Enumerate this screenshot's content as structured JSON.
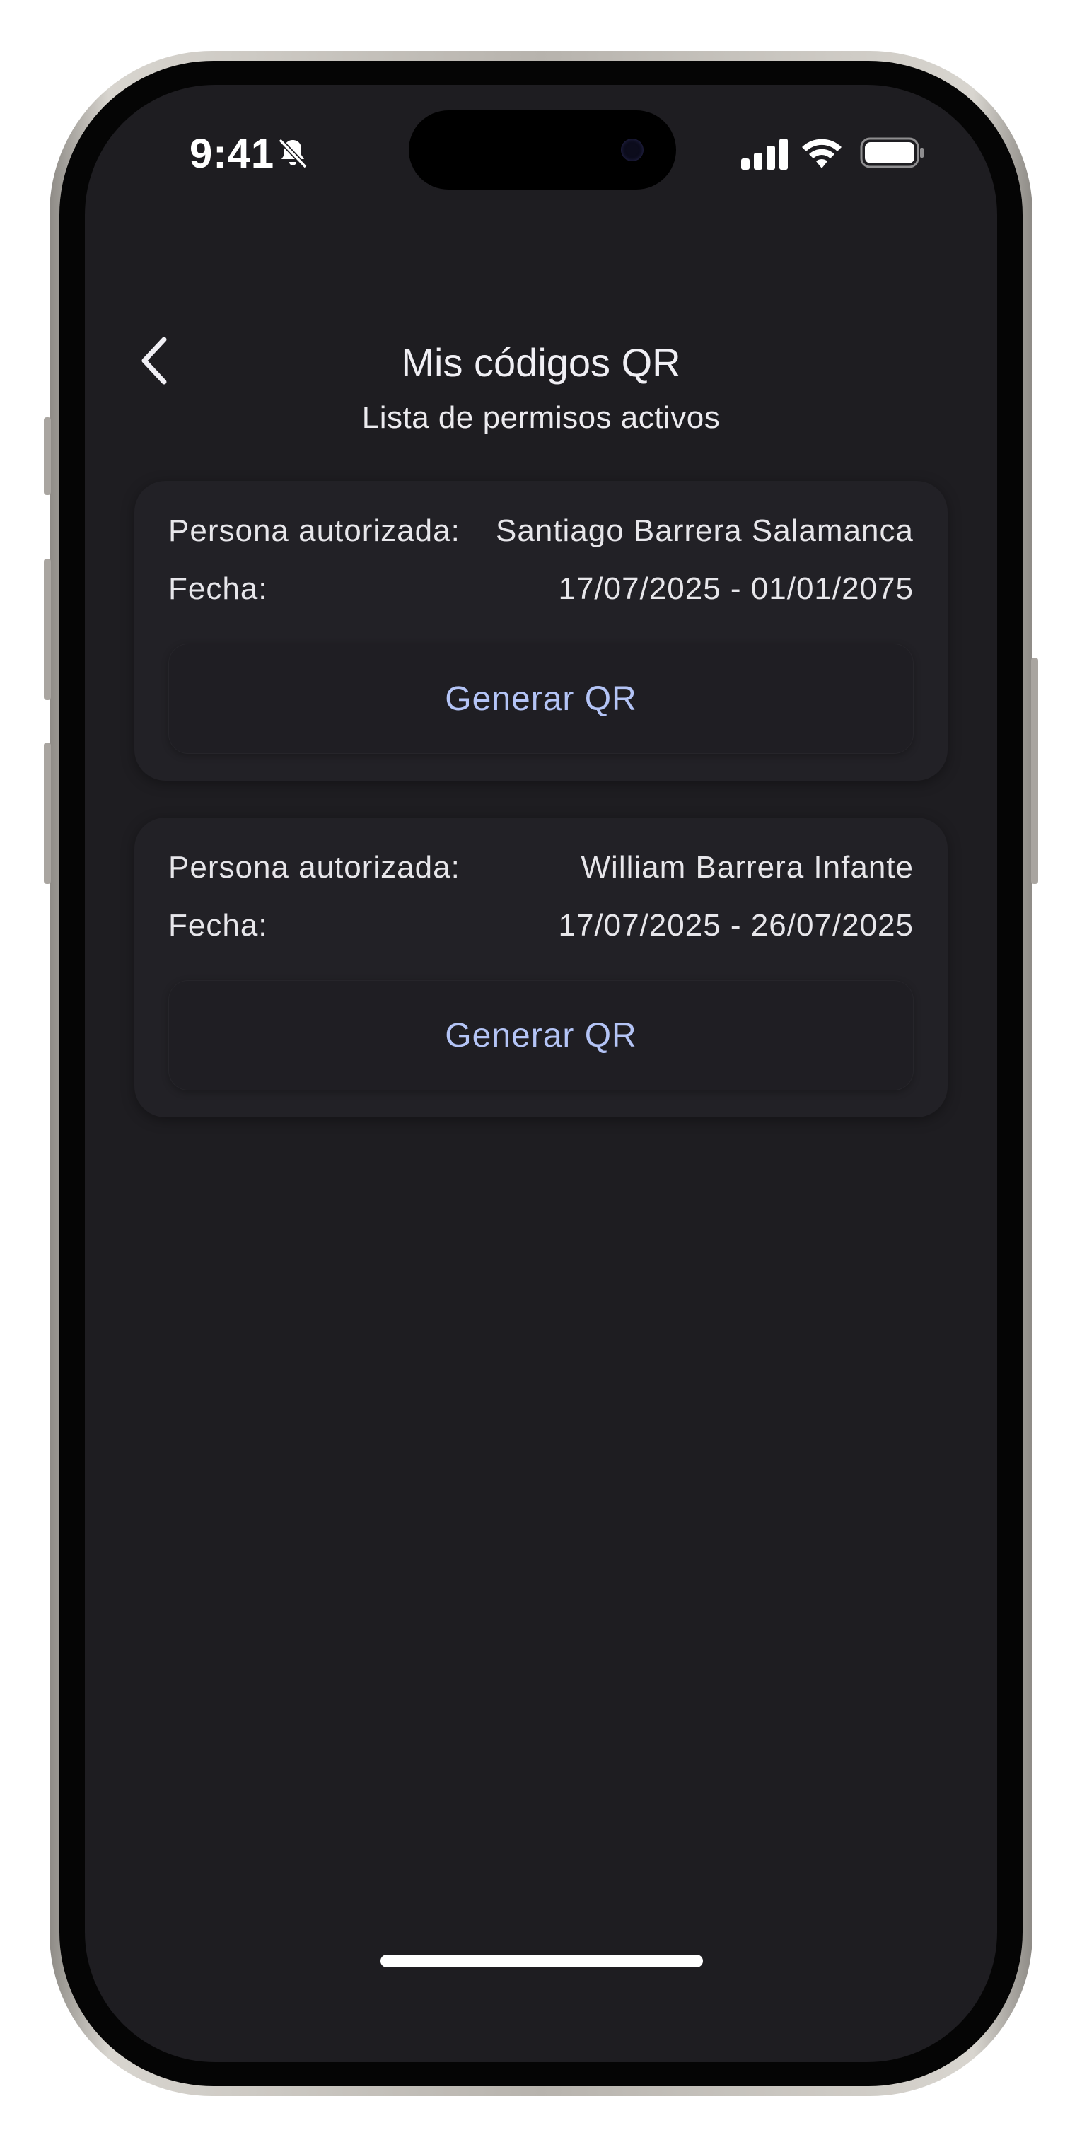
{
  "status_bar": {
    "time": "9:41"
  },
  "nav": {
    "title": "Mis códigos QR"
  },
  "section_title": "Lista de permisos activos",
  "permits": [
    {
      "person_label": "Persona autorizada:",
      "person_value": "Santiago Barrera Salamanca",
      "date_label": "Fecha:",
      "date_value": "17/07/2025 - 01/01/2075",
      "button_label": "Generar QR"
    },
    {
      "person_label": "Persona autorizada:",
      "person_value": "William Barrera Infante",
      "date_label": "Fecha:",
      "date_value": "17/07/2025 - 26/07/2025",
      "button_label": "Generar QR"
    }
  ],
  "icons": [
    "bell-slash-icon",
    "signal-icon",
    "wifi-icon",
    "battery-icon",
    "back-chevron-icon"
  ],
  "colors": {
    "background": "#1e1d21",
    "card": "#222126",
    "accent": "#b4c4f6",
    "text": "#ecebef"
  }
}
